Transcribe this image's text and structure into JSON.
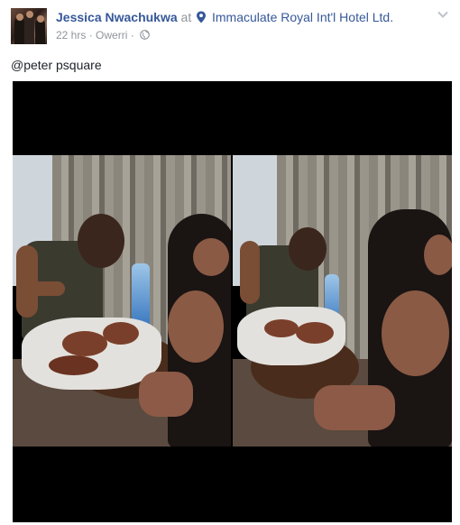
{
  "post": {
    "author": "Jessica Nwachukwa",
    "at_text": "at",
    "location": "Immaculate Royal Int'l Hotel Ltd.",
    "time": "22 hrs",
    "separator": "·",
    "place": "Owerri",
    "audience_icon": "globe-icon",
    "menu_icon": "chevron-down-icon",
    "caption": "@peter psquare",
    "photo_count": 2
  },
  "colors": {
    "link": "#365899",
    "muted": "#90949c",
    "text": "#1d2129",
    "media_bg": "#000000"
  }
}
